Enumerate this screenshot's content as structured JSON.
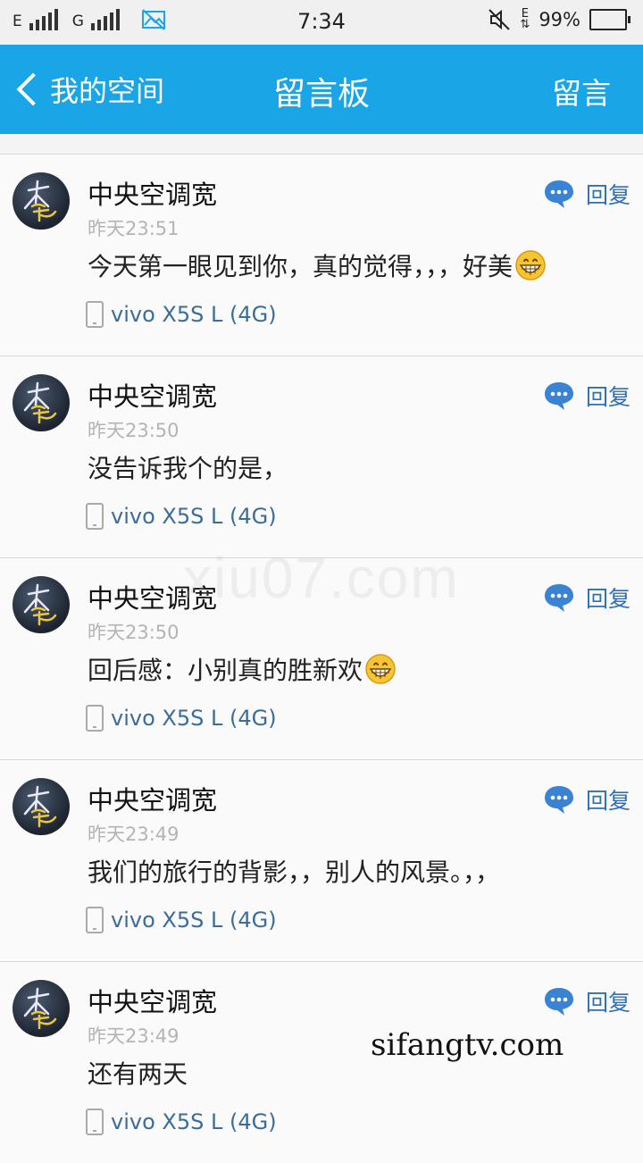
{
  "status_bar": {
    "net1": "E",
    "net2": "G",
    "time": "7:34",
    "data_label": "E",
    "battery_text": "99%",
    "battery_level": 0.99,
    "icons": [
      "signal-icon",
      "image-icon",
      "mute-icon",
      "data-arrows-icon",
      "battery-icon"
    ]
  },
  "nav": {
    "back_label": "我的空间",
    "title": "留言板",
    "action_label": "留言"
  },
  "accent_color": "#1aa6e6",
  "messages": [
    {
      "author": "中央空调宽",
      "time": "昨天23:51",
      "content": "今天第一眼见到你，真的觉得，，，好美",
      "emoji": true,
      "device": "vivo X5S L (4G)",
      "reply_label": "回复"
    },
    {
      "author": "中央空调宽",
      "time": "昨天23:50",
      "content": "没告诉我个的是，",
      "emoji": false,
      "device": "vivo X5S L (4G)",
      "reply_label": "回复"
    },
    {
      "author": "中央空调宽",
      "time": "昨天23:50",
      "content": "回后感：小别真的胜新欢",
      "emoji": true,
      "device": "vivo X5S L (4G)",
      "reply_label": "回复"
    },
    {
      "author": "中央空调宽",
      "time": "昨天23:49",
      "content": "我们的旅行的背影，，别人的风景。，，",
      "emoji": false,
      "device": "vivo X5S L (4G)",
      "reply_label": "回复"
    },
    {
      "author": "中央空调宽",
      "time": "昨天23:49",
      "content": "还有两天",
      "emoji": false,
      "device": "vivo X5S L (4G)",
      "reply_label": "回复"
    }
  ],
  "watermarks": [
    "xiu07.com",
    "sifangtv.com"
  ]
}
